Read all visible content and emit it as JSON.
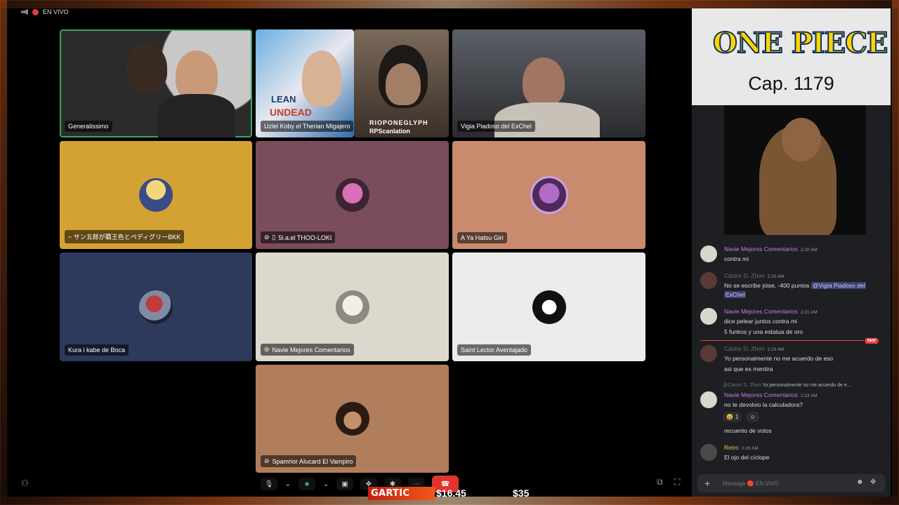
{
  "stream": {
    "live_label": "EN VIVO",
    "gartic_label": "GARTIC",
    "price_left": "$16.45",
    "price_right": "$35"
  },
  "tiles": [
    {
      "name": "Generalissimo",
      "muted": false
    },
    {
      "name": "Uzlel Koby el Therian Migajero",
      "muted": false
    },
    {
      "name": "Vigia Piadoso del ExChel",
      "muted": false
    },
    {
      "name": "~ サン五郎が覇王色とペディグリーBKK",
      "muted": false
    },
    {
      "name": "5i.a.el THOO-LOKI",
      "muted": true
    },
    {
      "name": "A Ya Hatsu Giri",
      "muted": false
    },
    {
      "name": "Kura i kabe de Boca",
      "muted": false
    },
    {
      "name": "Navie Mejores Comentarios",
      "muted": true
    },
    {
      "name": "Saint Lector Aventajado",
      "muted": false
    },
    {
      "name": "Spamrior Alucard El Vampiro",
      "muted": true
    }
  ],
  "video_overlay": {
    "lean_text": "LEAN",
    "undead_text": "UNDEAD",
    "rio_text": "RIOPONEGLYPH",
    "rp_text": "RPScanlation"
  },
  "branding": {
    "logo_text": "ONE PIECE",
    "chapter": "Cap. 1179"
  },
  "chat": {
    "messages": [
      {
        "author": "Navie Mejores Comentarios",
        "time": "2:20 AM",
        "color": "#c27de8",
        "lines": [
          "contra mi"
        ]
      },
      {
        "author": "Cástor D. Zhori",
        "time": "2:20 AM",
        "color": "#6d6f78",
        "lines": [
          "No se escribe joise, -400 puntos",
          "ExChel"
        ],
        "mention": "@Vigía Piadoso del"
      },
      {
        "author": "Navie Mejores Comentarios",
        "time": "2:21 AM",
        "color": "#c27de8",
        "lines": [
          "dice pelear juntos contra mi",
          "5 funkos y una estatua de oro"
        ]
      },
      {
        "author": "Cástor D. Zhori",
        "time": "2:23 AM",
        "color": "#6d6f78",
        "lines": [
          "Yo personalmente no me acuerdo de eso",
          "asi que es mentira"
        ]
      },
      {
        "author": "Navie Mejores Comentarios",
        "time": "2:23 AM",
        "color": "#c27de8",
        "lines": [
          "no te devolvio la calculadora?",
          "recuento de votos"
        ]
      },
      {
        "author": "Retro",
        "time": "2:28 AM",
        "color": "#f0c43a",
        "lines": [
          "El ojo del cíclope"
        ]
      }
    ],
    "new_tag": "NEW",
    "reply_ref_author": "@Cástor D. Zhori",
    "reply_ref_text": "Yo personalmente no me acuerdo de e...",
    "reaction_count": "1",
    "input_placeholder": "Message 🔴 EN VIVO"
  }
}
